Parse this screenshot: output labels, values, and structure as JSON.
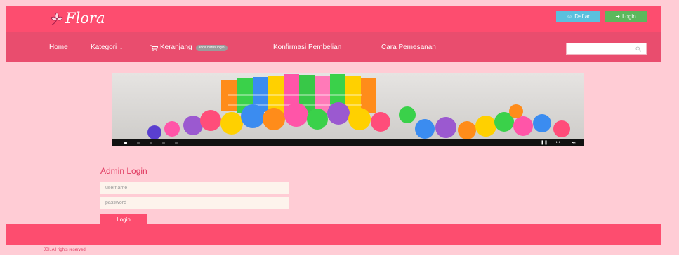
{
  "header": {
    "logo_text": "Flora",
    "register_label": "Daftar",
    "login_label": "Login",
    "register_icon": "users-icon",
    "login_icon": "sign-in-icon"
  },
  "nav": {
    "home": "Home",
    "category": "Kategori",
    "cart": "Keranjang",
    "cart_badge": "anda harus login",
    "confirm": "Konfirmasi Pembelian",
    "howto": "Cara Pemesanan",
    "search_placeholder": ""
  },
  "slider": {
    "slide_count": 5,
    "active_slide": 1,
    "controls": {
      "pause": "❚❚",
      "prev": "⏮",
      "next": "⏭"
    }
  },
  "login_form": {
    "title": "Admin Login",
    "username_placeholder": "username",
    "password_placeholder": "password",
    "submit_label": "Login"
  },
  "footer": {
    "copyright": "JBI. All rights reserved."
  },
  "colors": {
    "page_bg": "#ffccd5",
    "brand": "#fd4d6f",
    "nav": "#e94d6e",
    "register_btn": "#5bc0de",
    "login_btn": "#5cb85c"
  }
}
